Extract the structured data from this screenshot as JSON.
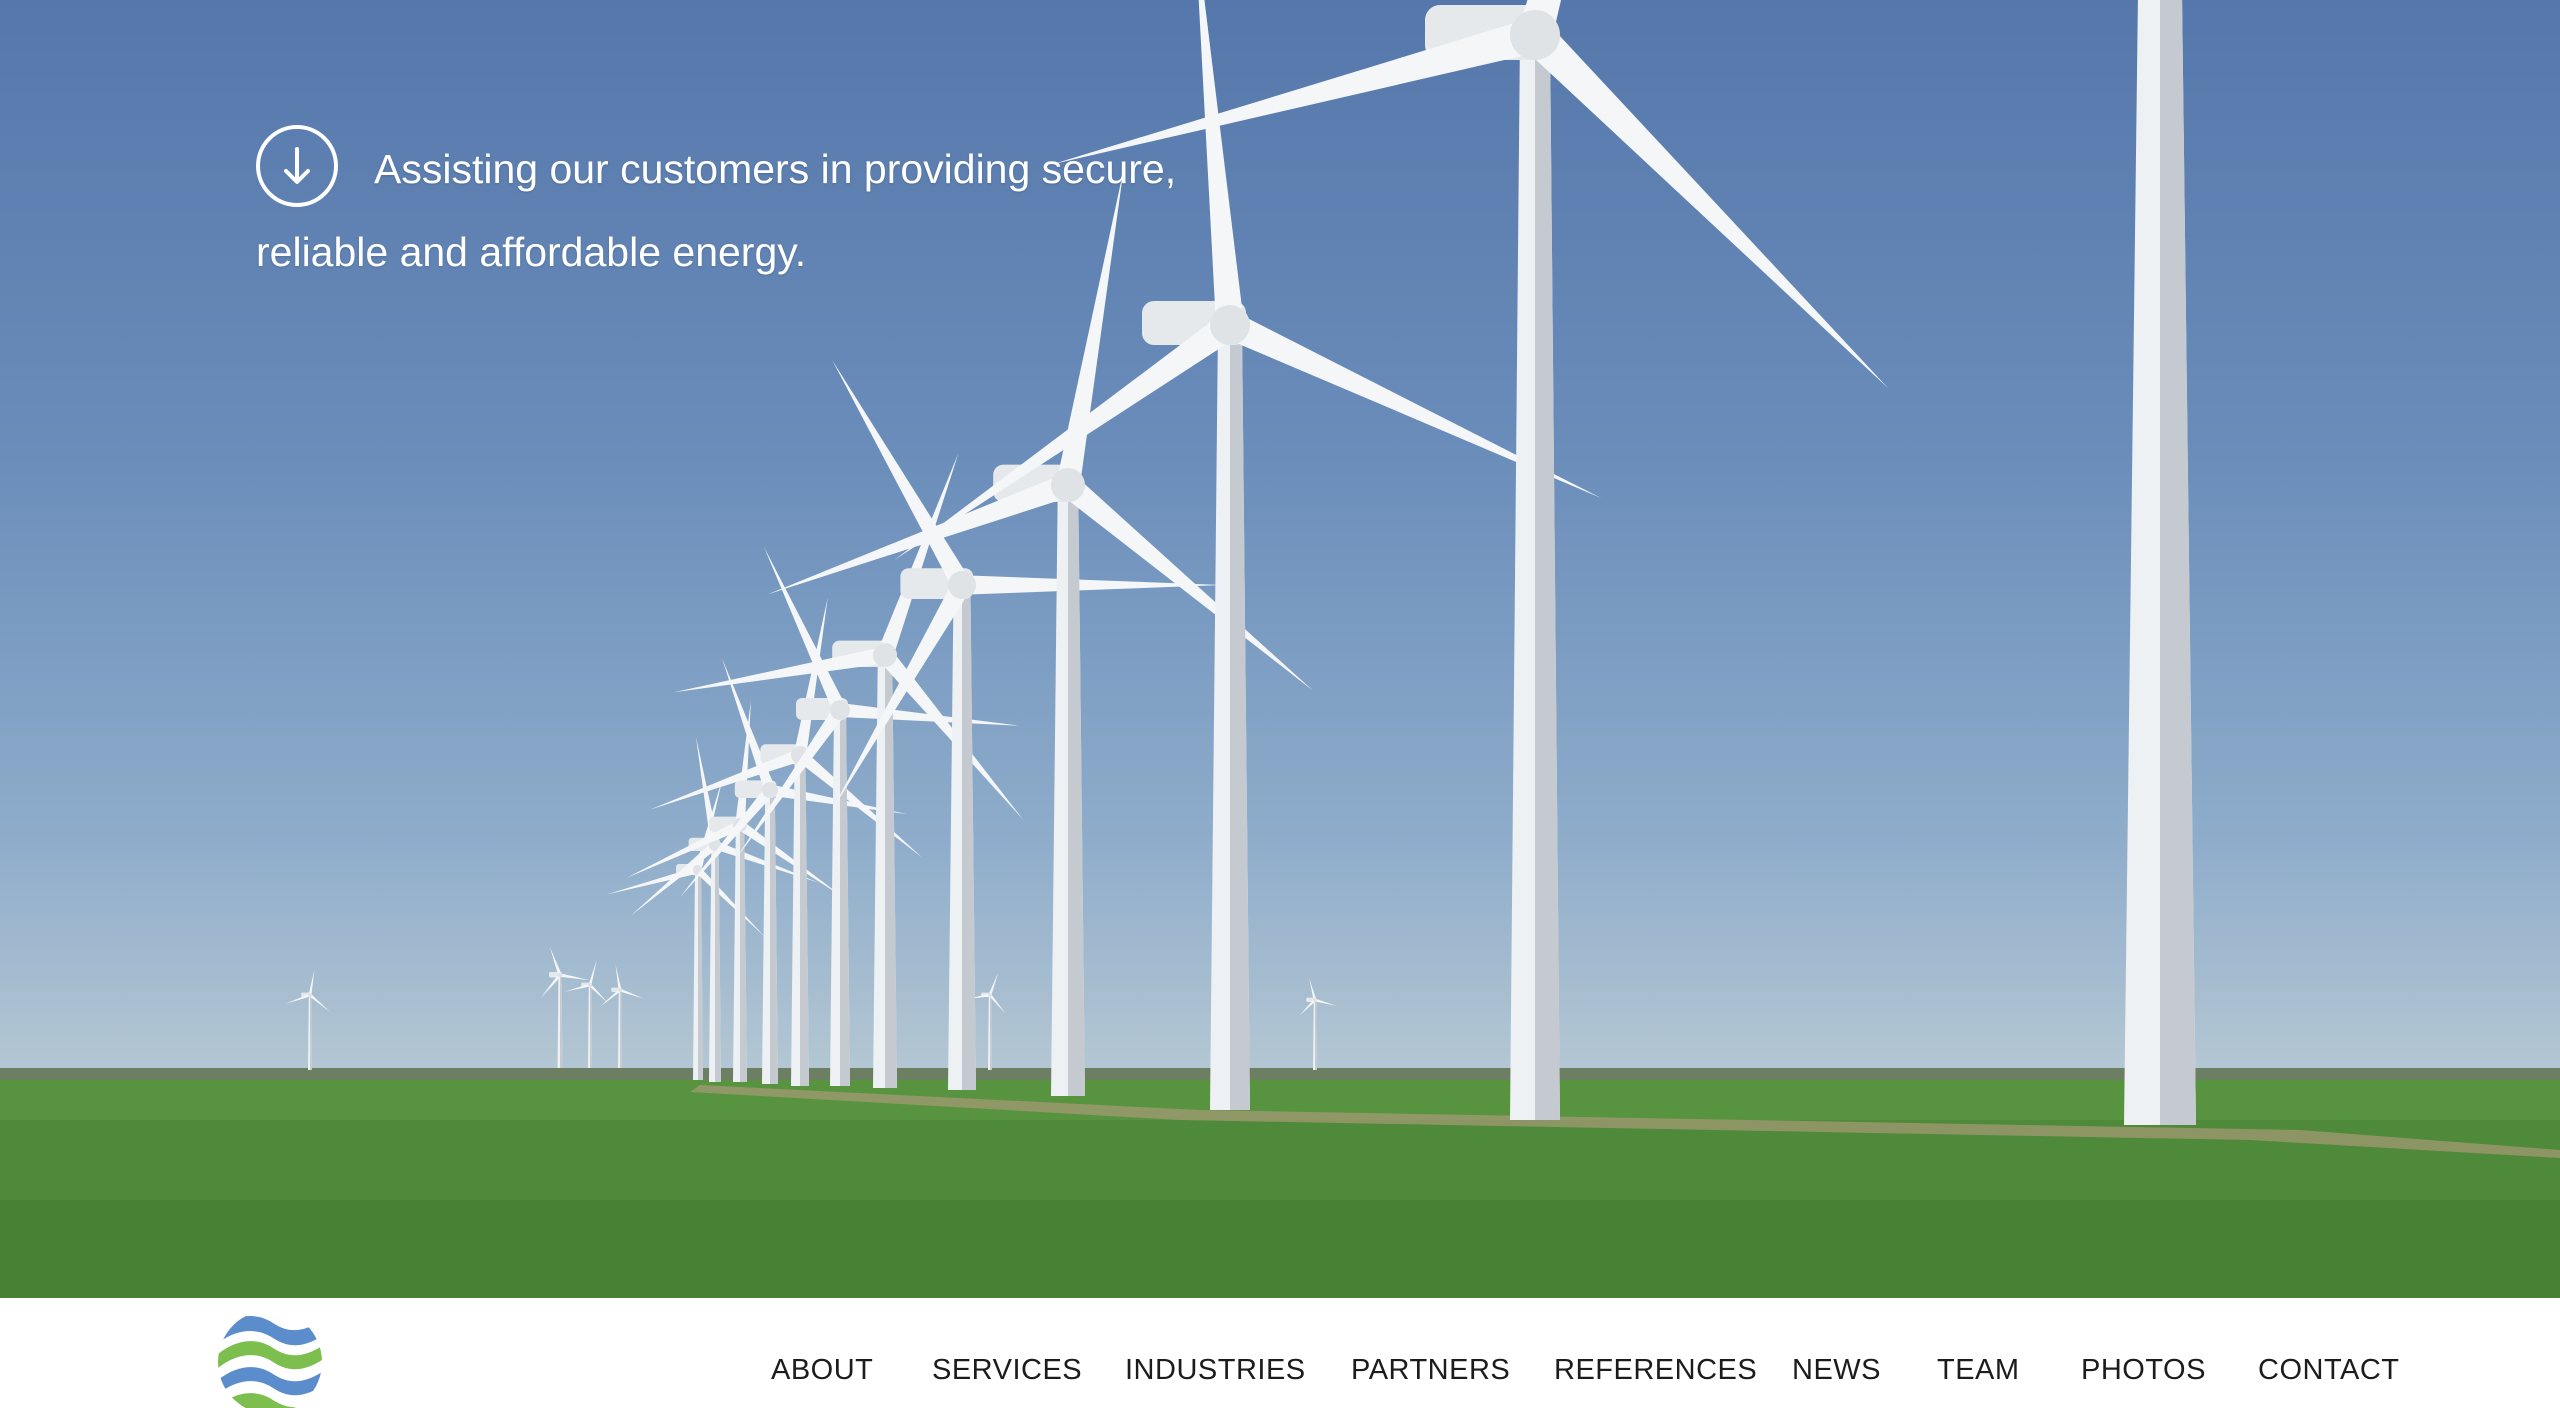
{
  "hero": {
    "icon": "arrow-down-circle-icon",
    "tagline": "Assisting our customers in providing secure, reliable and affordable energy."
  },
  "logo": {
    "icon": "wave-logo-icon",
    "colors": [
      "#5b8ccc",
      "#7cbf4e"
    ]
  },
  "nav": {
    "items": [
      {
        "label": "ABOUT"
      },
      {
        "label": "SERVICES"
      },
      {
        "label": "INDUSTRIES"
      },
      {
        "label": "PARTNERS"
      },
      {
        "label": "REFERENCES"
      },
      {
        "label": "NEWS"
      },
      {
        "label": "TEAM"
      },
      {
        "label": "PHOTOS"
      },
      {
        "label": "CONTACT"
      }
    ]
  }
}
